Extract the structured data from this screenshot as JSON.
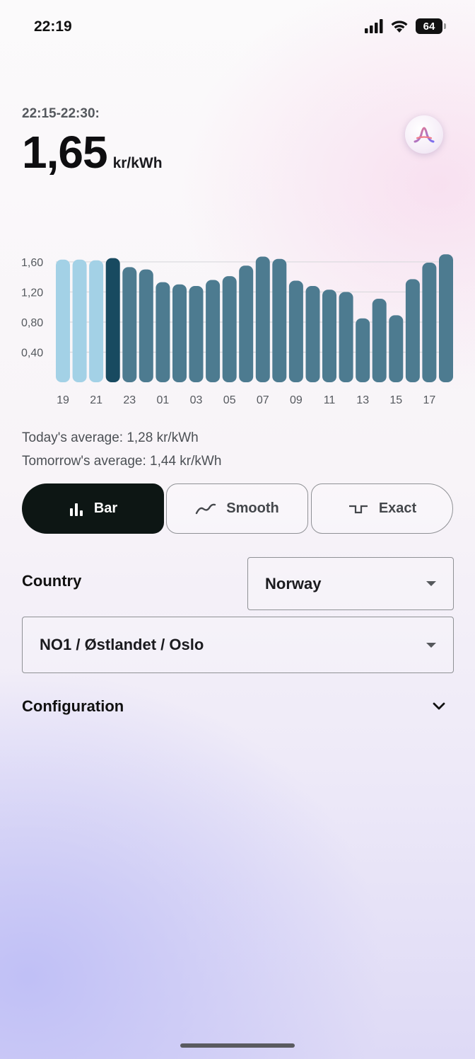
{
  "status_bar": {
    "time": "22:19",
    "battery": "64",
    "icons": [
      "signal-icon",
      "wifi-icon",
      "battery-icon"
    ]
  },
  "header": {
    "interval": "22:15-22:30:",
    "price": "1,65",
    "unit": "kr/kWh",
    "avatar_icon": "assistant-logo-icon"
  },
  "chart_data": {
    "type": "bar",
    "y_ticks": [
      "1,60",
      "1,20",
      "0,80",
      "0,40"
    ],
    "y_tick_values": [
      1.6,
      1.2,
      0.8,
      0.4
    ],
    "x_ticks": [
      "19",
      "21",
      "23",
      "01",
      "03",
      "05",
      "07",
      "09",
      "11",
      "13",
      "15",
      "17"
    ],
    "values": [
      1.63,
      1.63,
      1.62,
      1.65,
      1.53,
      1.5,
      1.33,
      1.3,
      1.28,
      1.36,
      1.41,
      1.55,
      1.67,
      1.64,
      1.35,
      1.28,
      1.23,
      1.2,
      0.85,
      1.11,
      0.89,
      1.37,
      1.59,
      1.7
    ],
    "bar_states": [
      "past",
      "past",
      "past",
      "current",
      "future",
      "future",
      "future",
      "future",
      "future",
      "future",
      "future",
      "future",
      "future",
      "future",
      "future",
      "future",
      "future",
      "future",
      "future",
      "future",
      "future",
      "future",
      "future",
      "future"
    ],
    "ylim": [
      0,
      1.75
    ],
    "grid": true,
    "colors": {
      "past": "#a3d1e6",
      "current": "#184a60",
      "future": "#4d7b90",
      "grid": "#d9d9dd"
    }
  },
  "averages": {
    "today": "Today's average: 1,28 kr/kWh",
    "tomorrow": "Tomorrow's average: 1,44 kr/kWh"
  },
  "chart_modes": {
    "bar": {
      "label": "Bar",
      "icon": "bar-chart-icon",
      "selected": true
    },
    "smooth": {
      "label": "Smooth",
      "icon": "smooth-line-icon",
      "selected": false
    },
    "exact": {
      "label": "Exact",
      "icon": "step-line-icon",
      "selected": false
    }
  },
  "country": {
    "label": "Country",
    "selected": "Norway"
  },
  "region": {
    "selected": "NO1 / Østlandet / Oslo"
  },
  "configuration": {
    "label": "Configuration",
    "icon": "chevron-down-icon"
  }
}
